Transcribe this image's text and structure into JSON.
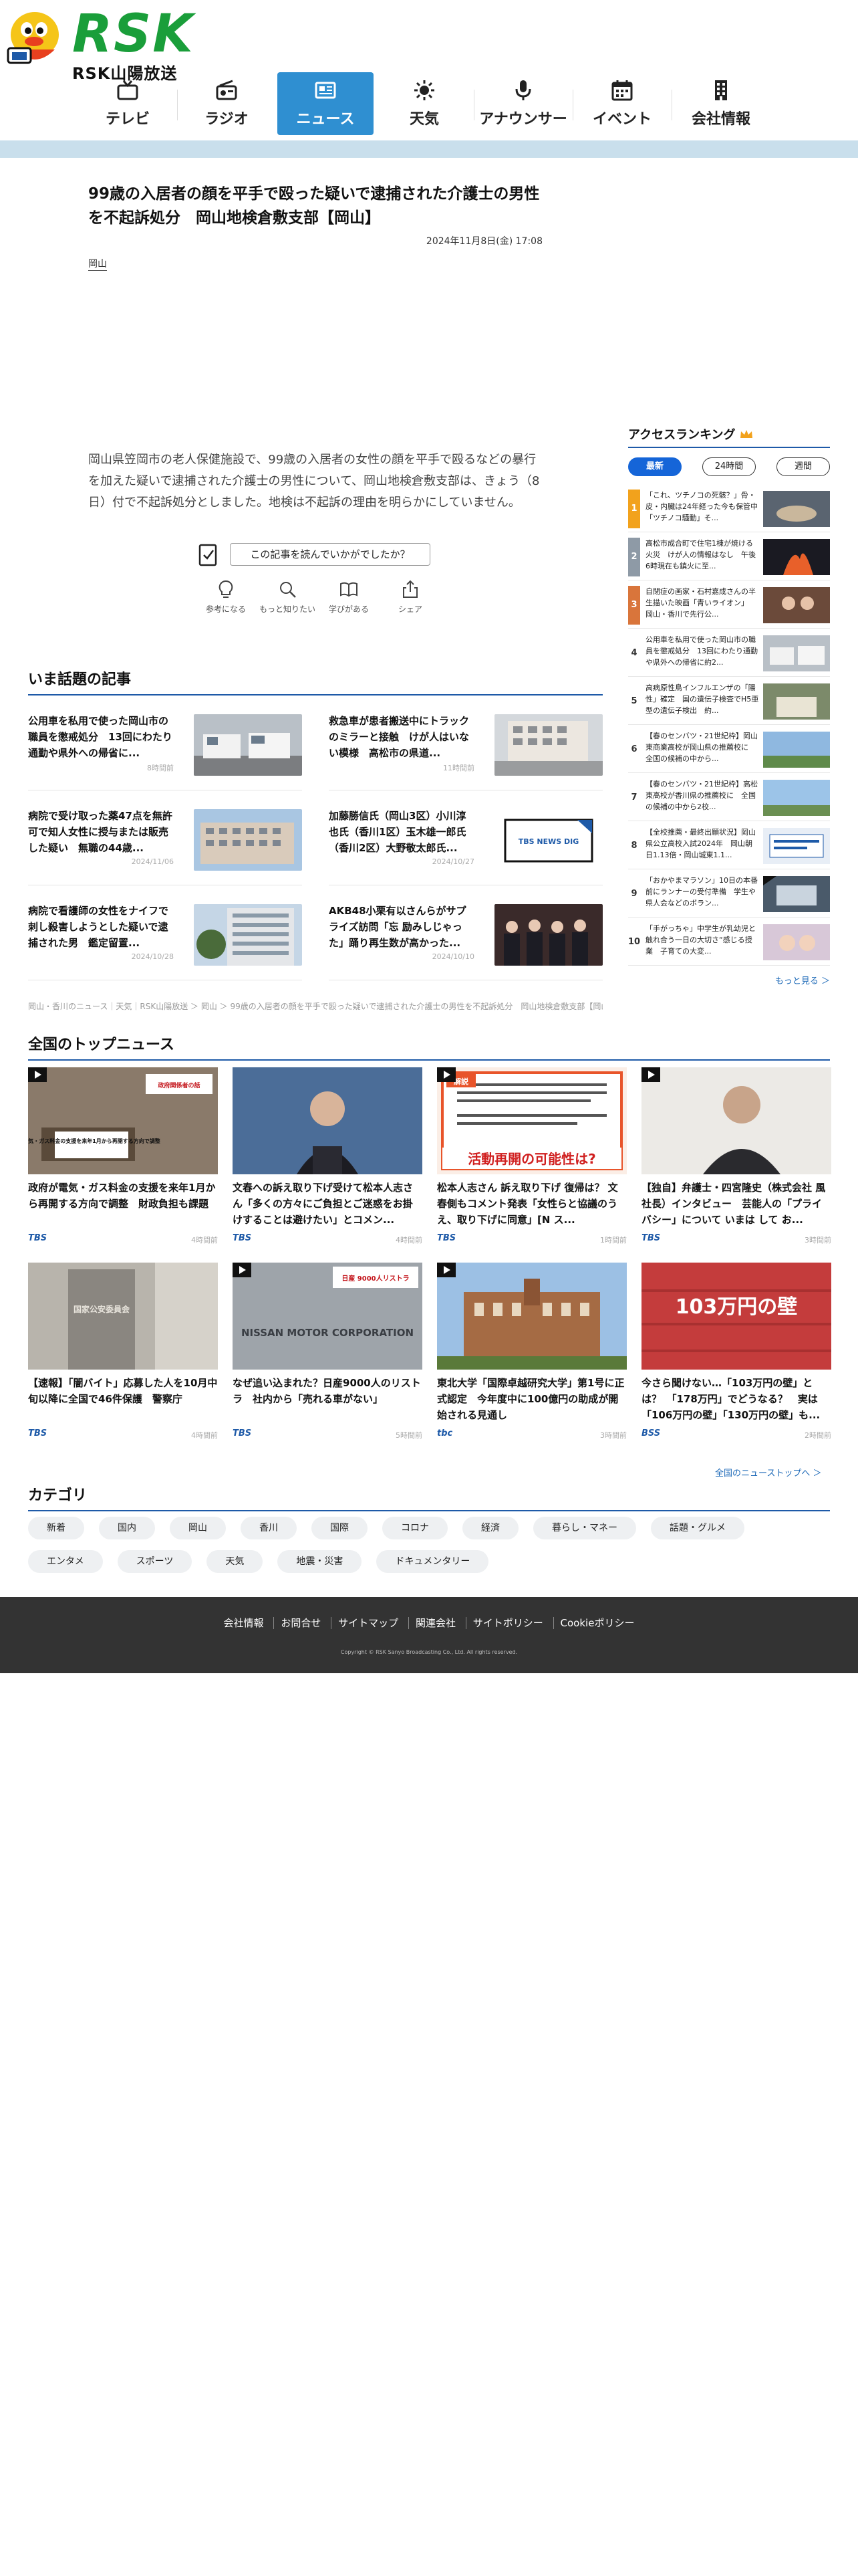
{
  "header": {
    "logo_text": "RSK",
    "logo_sub": "RSK山陽放送",
    "nav": [
      {
        "label": "テレビ",
        "icon": "tv-icon"
      },
      {
        "label": "ラジオ",
        "icon": "radio-icon"
      },
      {
        "label": "ニュース",
        "icon": "news-icon",
        "active": true
      },
      {
        "label": "天気",
        "icon": "sun-icon"
      },
      {
        "label": "アナウンサー",
        "icon": "microphone-icon"
      },
      {
        "label": "イベント",
        "icon": "calendar-icon"
      },
      {
        "label": "会社情報",
        "icon": "building-icon"
      }
    ]
  },
  "article": {
    "title": "99歳の入居者の顔を平手で殴った疑いで逮捕された介護士の男性を不起訴処分　岡山地検倉敷支部【岡山】",
    "date": "2024年11月8日(金) 17:08",
    "tag": "岡山",
    "body": "岡山県笠岡市の老人保健施設で、99歳の入居者の女性の顔を平手で殴るなどの暴行を加えた疑いで逮捕された介護士の男性について、岡山地検倉敷支部は、きょう（8日）付で不起訴処分としました。地検は不起訴の理由を明らかにしていません。",
    "feedback_button": "この記事を読んでいかがでしたか？",
    "reactions": [
      {
        "label": "参考になる",
        "icon": "lightbulb-icon"
      },
      {
        "label": "もっと知りたい",
        "icon": "magnifier-icon"
      },
      {
        "label": "学びがある",
        "icon": "book-icon"
      },
      {
        "label": "シェア",
        "icon": "share-icon"
      }
    ]
  },
  "ima": {
    "title": "いま話題の記事",
    "items": [
      {
        "title": "公用車を私用で使った岡山市の職員を懲戒処分　13回にわたり通勤や県外への帰省に...",
        "date": "8時間前"
      },
      {
        "title": "救急車が患者搬送中にトラックのミラーと接触　けが人はいない模様　高松市の県道...",
        "date": "11時間前"
      },
      {
        "title": "病院で受け取った薬47点を無許可で知人女性に授与または販売した疑い　無職の44歳...",
        "date": "2024/11/06"
      },
      {
        "title": "加藤勝信氏（岡山3区）小川淳也氏（香川1区）玉木雄一郎氏（香川2区）大野敬太郎氏...",
        "date": "2024/10/27"
      },
      {
        "title": "病院で看護師の女性をナイフで刺し殺害しようとした疑いで逮捕された男　鑑定留置...",
        "date": "2024/10/28"
      },
      {
        "title": "AKB48小栗有以さんらがサプライズ訪問「忘 励みしじゃった」踊り再生数が高かった...",
        "date": "2024/10/10"
      }
    ]
  },
  "breadcrumb": "岡山・香川のニュース｜天気｜RSK山陽放送 ＞ 岡山 ＞ 99歳の入居者の顔を平手で殴った疑いで逮捕された介護士の男性を不起訴処分　岡山地検倉敷支部【岡山】",
  "ranking": {
    "title": "アクセスランキング",
    "tabs": [
      "最新",
      "24時間",
      "週間"
    ],
    "items": [
      {
        "n": "1",
        "text": "「これ、ツチノコの死骸？」骨・皮・内臓は24年経った今も保管中「ツチノコ騒動」そ..."
      },
      {
        "n": "2",
        "text": "高松市成合町で住宅1棟が焼ける火災　けが人の情報はなし　午後6時現在も鎮火に至..."
      },
      {
        "n": "3",
        "text": "自閉症の画家・石村嘉成さんの半生描いた映画「青いライオン」　岡山・香川で先行公..."
      },
      {
        "n": "4",
        "text": "公用車を私用で使った岡山市の職員を懲戒処分　13回にわたり通勤や県外への帰省に約2..."
      },
      {
        "n": "5",
        "text": "高病原性鳥インフルエンザの「陽性」確定　国の遺伝子検査でH5亜型の遺伝子検出　約..."
      },
      {
        "n": "6",
        "text": "【春のセンバツ・21世紀枠】岡山東商業高校が岡山県の推薦校に　全国の候補の中から..."
      },
      {
        "n": "7",
        "text": "【春のセンバツ・21世紀枠】高松東高校が香川県の推薦校に　全国の候補の中から2校..."
      },
      {
        "n": "8",
        "text": "【全校推薦・最終出願状況】岡山県公立高校入試2024年　岡山朝日1.13倍・岡山城東1.1..."
      },
      {
        "n": "9",
        "text": "「おかやまマラソン」10日の本番前にランナーの受付準備　学生や県人会などのボラン..."
      },
      {
        "n": "10",
        "text": "「手がっちゃ」中学生が乳幼児と触れ合う一日の大切さ“感じる授業　子育ての大変..."
      }
    ],
    "more": "もっと見る ＞"
  },
  "zenkoku": {
    "title": "全国のトップニュース",
    "items": [
      {
        "title": "政府が電気・ガス料金の支援を来年1月から再開する方向で調整　財政負担も課題",
        "src": "TBS",
        "date": "4時間前",
        "video": true,
        "overlay": "電気・ガス料金の支援を来年1月から再開する方向で調整",
        "badge": "政府関係者の話"
      },
      {
        "title": "文春への訴え取り下げ受けて松本人志さん「多くの方々にご負担とご迷惑をお掛けすることは避けたい」とコメン...",
        "src": "TBS",
        "date": "4時間前",
        "video": false,
        "overlay": "",
        "badge": ""
      },
      {
        "title": "松本人志さん 訴え取り下げ 復帰は？ 文春側もコメント発表「女性らと協議のうえ、取り下げに同意」[N ス...",
        "src": "TBS",
        "date": "1時間前",
        "video": true,
        "overlay": "活動再開の可能性は?",
        "badge": "解説"
      },
      {
        "title": "【独自】弁護士・四宮隆史（株式会社 風 社長）インタビュー　芸能人の「プライバシー」について いまは して お...",
        "src": "TBS",
        "date": "3時間前",
        "video": true,
        "overlay": "",
        "badge": ""
      },
      {
        "title": "【速報】「闇バイト」応募した人を10月中旬以降に全国で46件保護　警察庁",
        "src": "TBS",
        "date": "4時間前",
        "video": false,
        "overlay": "国家公安委員会",
        "badge": ""
      },
      {
        "title": "なぜ追い込まれた？日産9000人のリストラ　社内から「売れる車がない」",
        "src": "TBS",
        "date": "5時間前",
        "video": true,
        "overlay": "NISSAN MOTOR CORPORATION",
        "badge": "日産 9000人リストラ"
      },
      {
        "title": "東北大学「国際卓越研究大学」第1号に正式認定　今年度中に100億円の助成が開始される見通し",
        "src": "tbc",
        "date": "3時間前",
        "video": true,
        "overlay": "",
        "badge": ""
      },
      {
        "title": "今さら聞けない…「103万円の壁」とは？　「178万円」でどうなる？　実は「106万円の壁」「130万円の壁」も...",
        "src": "BSS",
        "date": "2時間前",
        "video": false,
        "overlay": "103万円の壁",
        "badge": ""
      }
    ],
    "more": "全国のニューストップへ ＞"
  },
  "categories": {
    "title": "カテゴリ",
    "items": [
      "新着",
      "国内",
      "岡山",
      "香川",
      "国際",
      "コロナ",
      "経済",
      "暮らし・マネー",
      "話題・グルメ",
      "エンタメ",
      "スポーツ",
      "天気",
      "地震・災害",
      "ドキュメンタリー"
    ]
  },
  "footer": {
    "links": [
      "会社情報",
      "お問合せ",
      "サイトマップ",
      "関連会社",
      "サイトポリシー",
      "Cookieポリシー"
    ],
    "copyright": "Copyright © RSK Sanyo Broadcasting Co., Ltd. All rights reserved."
  },
  "colors": {
    "accent": "#2f8fd1",
    "section_rule": "#1e5aa8",
    "logo": "#1a9e3a",
    "footer": "#333333"
  }
}
